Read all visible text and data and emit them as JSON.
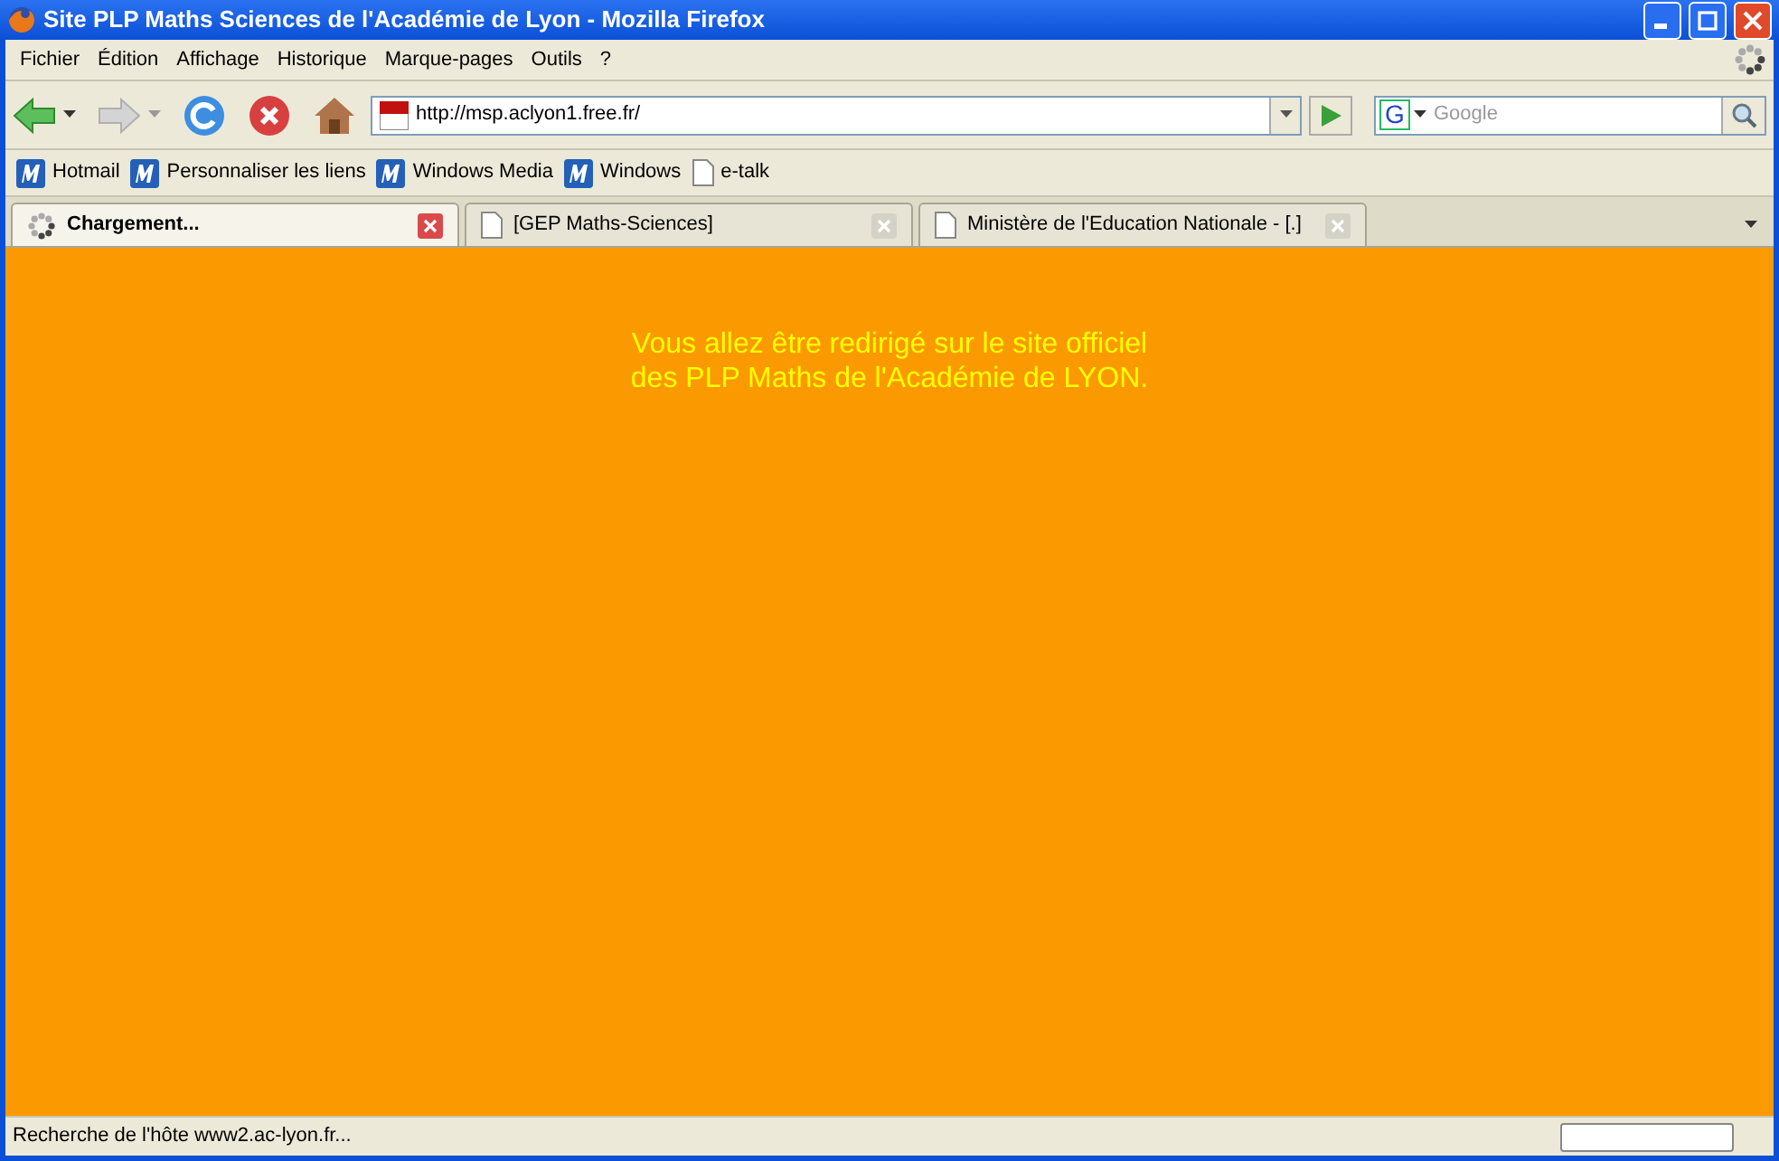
{
  "window": {
    "title": "Site PLP Maths Sciences de l'Académie de Lyon - Mozilla Firefox"
  },
  "menu": [
    "Fichier",
    "Édition",
    "Affichage",
    "Historique",
    "Marque-pages",
    "Outils",
    "?"
  ],
  "address": {
    "value": "http://msp.aclyon1.free.fr/"
  },
  "search": {
    "engine_label": "G",
    "placeholder": "Google"
  },
  "bookmarks": [
    {
      "label": "Hotmail",
      "kind": "site"
    },
    {
      "label": "Personnaliser les liens",
      "kind": "site"
    },
    {
      "label": "Windows Media",
      "kind": "site"
    },
    {
      "label": "Windows",
      "kind": "site"
    },
    {
      "label": "e-talk",
      "kind": "page"
    }
  ],
  "tabs": [
    {
      "label": "Chargement...",
      "selected": true,
      "loading": true
    },
    {
      "label": "[GEP Maths-Sciences]",
      "selected": false,
      "loading": false
    },
    {
      "label": "Ministère de l'Education Nationale - [.]",
      "selected": false,
      "loading": false
    }
  ],
  "page": {
    "lines": [
      "Vous allez être redirigé sur le site officiel",
      "des PLP Maths de l'Académie de LYON."
    ]
  },
  "status_bar": {
    "text": "Recherche de l'hôte www2.ac-lyon.fr..."
  }
}
